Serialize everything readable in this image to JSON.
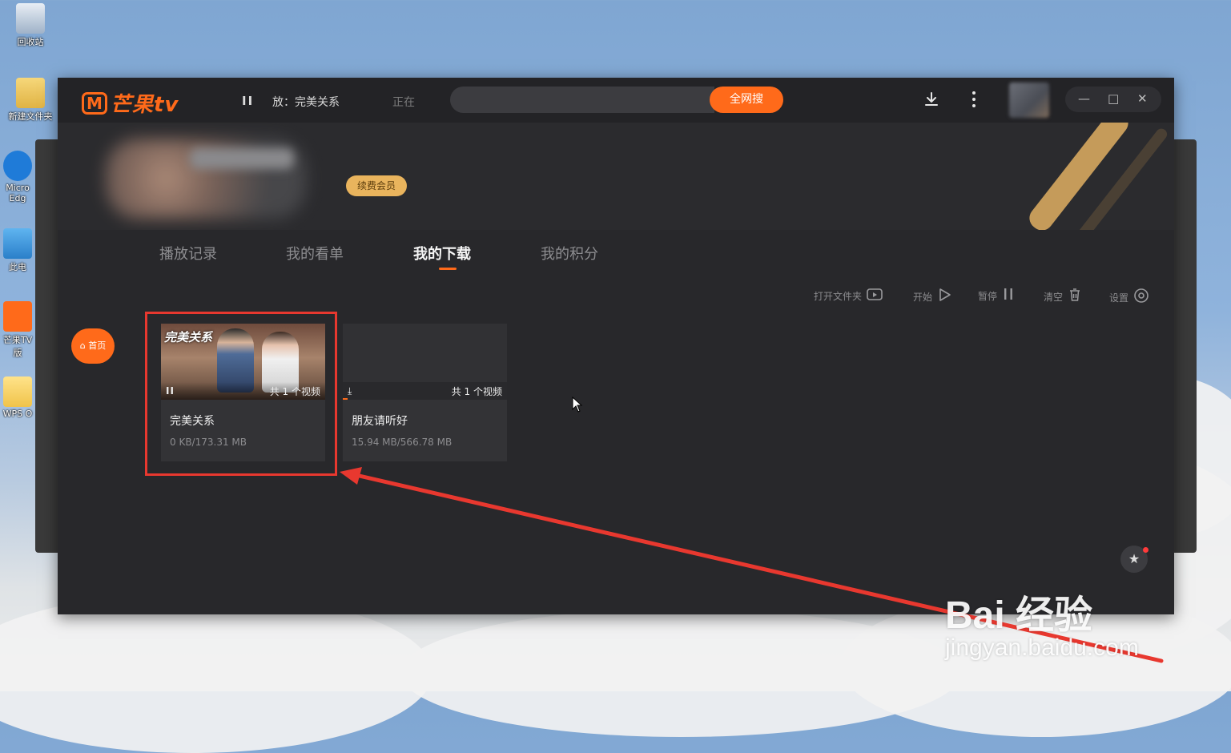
{
  "desktop": {
    "icons": [
      {
        "label": "回收站"
      },
      {
        "label": "新建文件夹"
      },
      {
        "label": "Micro Edg"
      },
      {
        "label": "此电"
      },
      {
        "label": "芒果TV 版"
      },
      {
        "label": "WPS O"
      }
    ]
  },
  "app": {
    "logo_text": "芒果tv",
    "logo_mark": "M",
    "pause_glyph": "II",
    "now_playing": "放：完美关系",
    "status_partial": "正在",
    "search": {
      "placeholder": "",
      "button": "全网搜"
    },
    "title_icons": [
      "download-icon",
      "more-icon"
    ],
    "window_controls": {
      "minimize": "—",
      "maximize": "□",
      "close": "✕"
    },
    "profile": {
      "vip_badge": "续费会员"
    },
    "tabs": [
      {
        "label": "播放记录",
        "active": false
      },
      {
        "label": "我的看单",
        "active": false
      },
      {
        "label": "我的下载",
        "active": true
      },
      {
        "label": "我的积分",
        "active": false
      }
    ],
    "toolbar": {
      "open_folder": "打开文件夹",
      "start": "开始",
      "pause": "暂停",
      "clear": "清空",
      "settings": "设置"
    },
    "home_button": "首页",
    "downloads": [
      {
        "title": "完美关系",
        "size": "0 KB/173.31 MB",
        "count": "共 1 个视频",
        "thumb_text": "完美关系",
        "state_glyph": "II",
        "progress": 0.0
      },
      {
        "title": "朋友请听好",
        "size": "15.94 MB/566.78 MB",
        "count": "共 1 个视频",
        "thumb_text": "",
        "state_glyph": "⤓",
        "progress": 0.028
      }
    ]
  },
  "watermark": {
    "brand": "Bai 经验",
    "url": "jingyan.baidu.com"
  },
  "colors": {
    "accent": "#ff6a1a",
    "annotation": "#e8382f",
    "vip": "#e9b45d"
  }
}
